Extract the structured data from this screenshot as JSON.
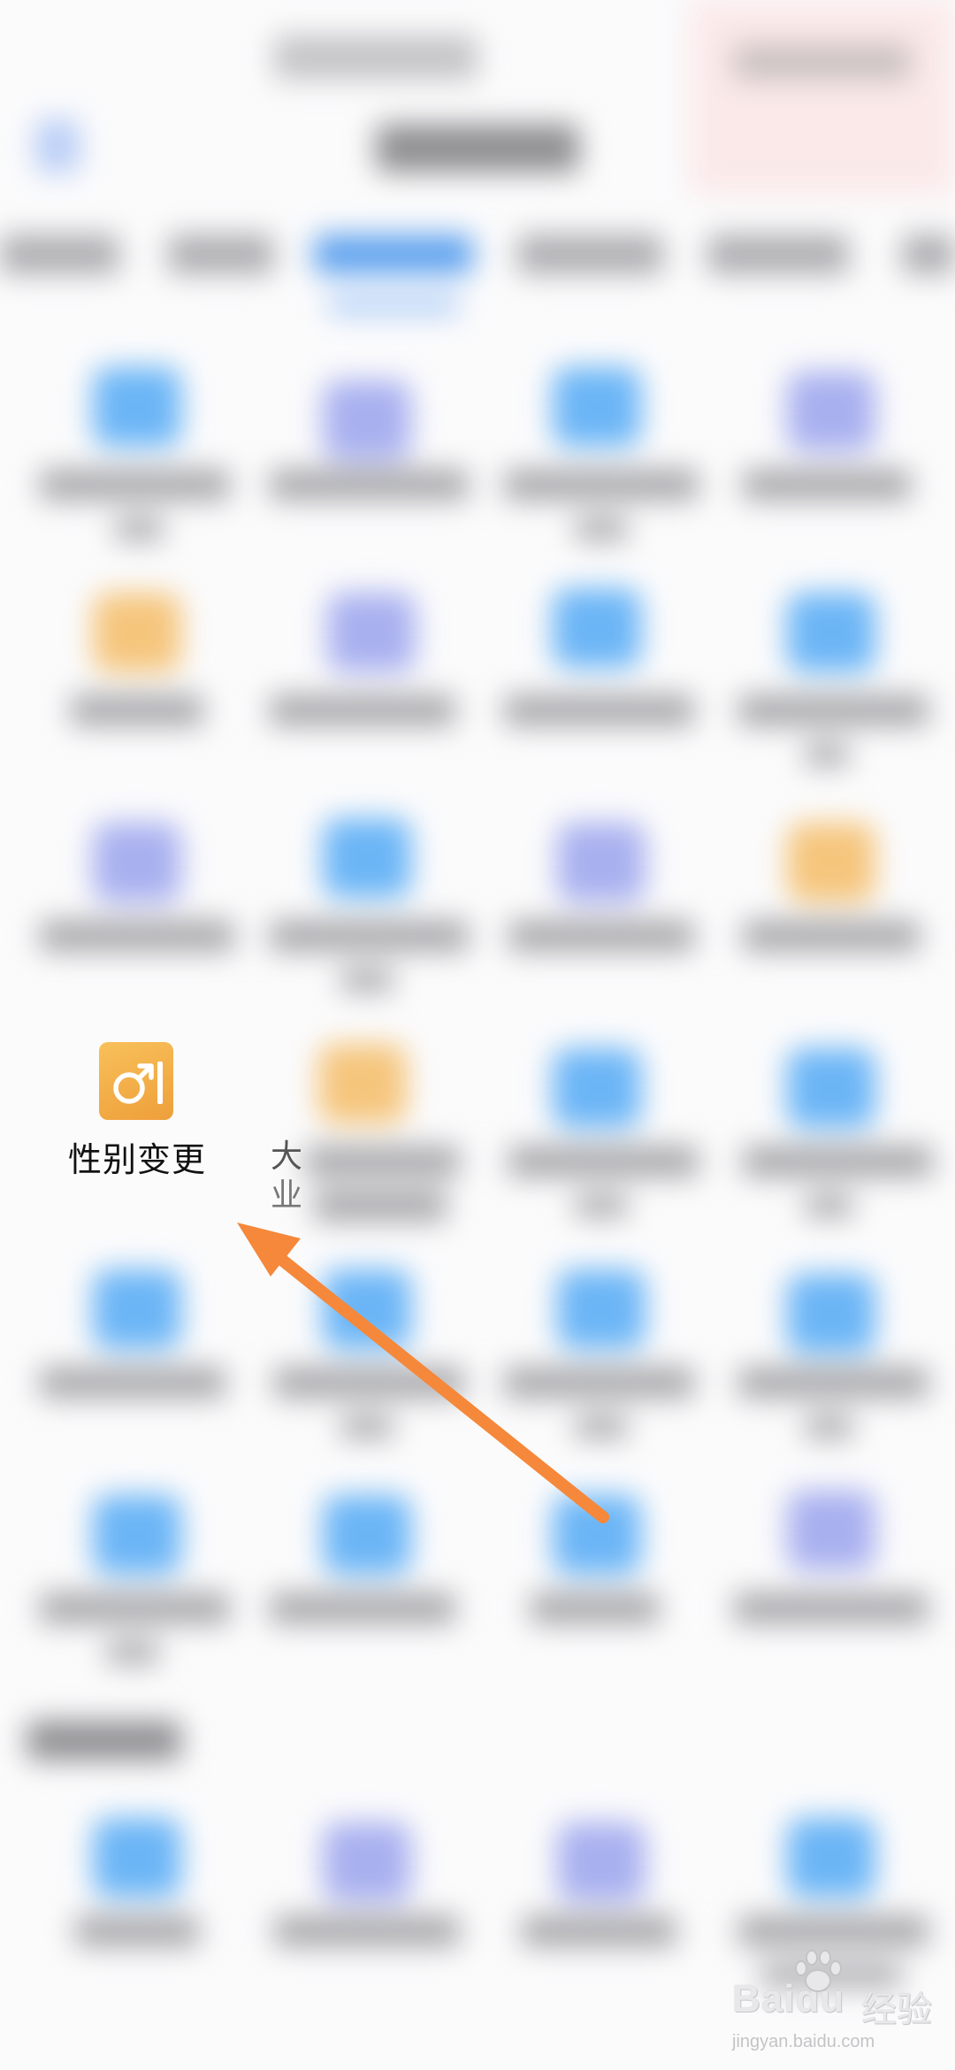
{
  "highlighted_item": {
    "label": "性别变更",
    "icon": "gender-male-icon",
    "icon_color": "#f1a63e"
  },
  "partial_neighbor_label": [
    "大",
    "业"
  ],
  "arrow": {
    "color": "#f5883a"
  },
  "watermark": {
    "logo": "Baidu",
    "brand_cn": "经验",
    "url": "jingyan.baidu.com"
  },
  "colors": {
    "accent_blue": "#5fa2ee",
    "icon_blue": "#6bb5f6",
    "icon_purple": "#a8b0ef",
    "icon_orange": "#f5c57c"
  }
}
